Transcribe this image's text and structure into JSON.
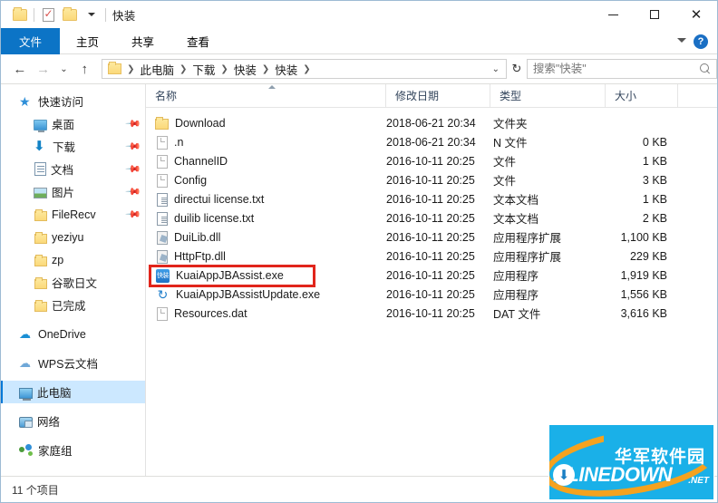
{
  "window": {
    "title": "快装",
    "quick_access": [
      {
        "name": "folder-icon",
        "label": "快装"
      },
      {
        "name": "properties-icon",
        "label": "属性"
      },
      {
        "name": "new-folder-icon",
        "label": "新建文件夹"
      }
    ],
    "controls": {
      "minimize": "—",
      "maximize": "☐",
      "close": "✕"
    }
  },
  "ribbon": {
    "tabs": [
      {
        "label": "文件",
        "active": true
      },
      {
        "label": "主页",
        "active": false
      },
      {
        "label": "共享",
        "active": false
      },
      {
        "label": "查看",
        "active": false
      }
    ],
    "expand_label": "展开功能区",
    "help_label": "?"
  },
  "navbar": {
    "back": "←",
    "forward": "→",
    "recent": "⌄",
    "up": "↑",
    "breadcrumbs": [
      "此电脑",
      "下载",
      "快装",
      "快装"
    ],
    "history_caret": "⌄",
    "refresh": "↻"
  },
  "search": {
    "placeholder": "搜索\"快装\"",
    "value": "",
    "icon": "search-icon"
  },
  "sidebar": {
    "items": [
      {
        "label": "快速访问",
        "icon": "star-icon",
        "level": 0,
        "pinned": false,
        "selected": false
      },
      {
        "label": "桌面",
        "icon": "desktop-icon",
        "level": 1,
        "pinned": true,
        "selected": false
      },
      {
        "label": "下载",
        "icon": "download-icon",
        "level": 1,
        "pinned": true,
        "selected": false
      },
      {
        "label": "文档",
        "icon": "documents-icon",
        "level": 1,
        "pinned": true,
        "selected": false
      },
      {
        "label": "图片",
        "icon": "pictures-icon",
        "level": 1,
        "pinned": true,
        "selected": false
      },
      {
        "label": "FileRecv",
        "icon": "folder-icon",
        "level": 1,
        "pinned": true,
        "selected": false
      },
      {
        "label": "yeziyu",
        "icon": "folder-icon",
        "level": 1,
        "pinned": false,
        "selected": false
      },
      {
        "label": "zp",
        "icon": "folder-icon",
        "level": 1,
        "pinned": false,
        "selected": false
      },
      {
        "label": "谷歌日文",
        "icon": "folder-icon",
        "level": 1,
        "pinned": false,
        "selected": false
      },
      {
        "label": "已完成",
        "icon": "folder-icon",
        "level": 1,
        "pinned": false,
        "selected": false
      },
      {
        "label": "OneDrive",
        "icon": "onedrive-icon",
        "level": 0,
        "pinned": false,
        "selected": false
      },
      {
        "label": "WPS云文档",
        "icon": "wps-cloud-icon",
        "level": 0,
        "pinned": false,
        "selected": false
      },
      {
        "label": "此电脑",
        "icon": "this-pc-icon",
        "level": 0,
        "pinned": false,
        "selected": true
      },
      {
        "label": "网络",
        "icon": "network-icon",
        "level": 0,
        "pinned": false,
        "selected": false
      },
      {
        "label": "家庭组",
        "icon": "homegroup-icon",
        "level": 0,
        "pinned": false,
        "selected": false
      }
    ]
  },
  "filelist": {
    "columns": [
      {
        "label": "名称",
        "sorted": "asc"
      },
      {
        "label": "修改日期",
        "sorted": null
      },
      {
        "label": "类型",
        "sorted": null
      },
      {
        "label": "大小",
        "sorted": null
      }
    ],
    "rows": [
      {
        "name": "Download",
        "date": "2018-06-21 20:34",
        "type": "文件夹",
        "size": "",
        "icon": "folder-icon",
        "highlighted": false
      },
      {
        "name": ".n",
        "date": "2018-06-21 20:34",
        "type": "N 文件",
        "size": "0 KB",
        "icon": "generic-file-icon",
        "highlighted": false
      },
      {
        "name": "ChannelID",
        "date": "2016-10-11 20:25",
        "type": "文件",
        "size": "1 KB",
        "icon": "generic-file-icon",
        "highlighted": false
      },
      {
        "name": "Config",
        "date": "2016-10-11 20:25",
        "type": "文件",
        "size": "3 KB",
        "icon": "generic-file-icon",
        "highlighted": false
      },
      {
        "name": "directui license.txt",
        "date": "2016-10-11 20:25",
        "type": "文本文档",
        "size": "1 KB",
        "icon": "text-file-icon",
        "highlighted": false
      },
      {
        "name": "duilib license.txt",
        "date": "2016-10-11 20:25",
        "type": "文本文档",
        "size": "2 KB",
        "icon": "text-file-icon",
        "highlighted": false
      },
      {
        "name": "DuiLib.dll",
        "date": "2016-10-11 20:25",
        "type": "应用程序扩展",
        "size": "1,100 KB",
        "icon": "dll-file-icon",
        "highlighted": false
      },
      {
        "name": "HttpFtp.dll",
        "date": "2016-10-11 20:25",
        "type": "应用程序扩展",
        "size": "229 KB",
        "icon": "dll-file-icon",
        "highlighted": false
      },
      {
        "name": "KuaiAppJBAssist.exe",
        "date": "2016-10-11 20:25",
        "type": "应用程序",
        "size": "1,919 KB",
        "icon": "kuaiapp-exe-icon",
        "icon_text": "快装",
        "highlighted": true
      },
      {
        "name": "KuaiAppJBAssistUpdate.exe",
        "date": "2016-10-11 20:25",
        "type": "应用程序",
        "size": "1,556 KB",
        "icon": "update-exe-icon",
        "highlighted": false
      },
      {
        "name": "Resources.dat",
        "date": "2016-10-11 20:25",
        "type": "DAT 文件",
        "size": "3,616 KB",
        "icon": "dat-file-icon",
        "highlighted": false
      }
    ]
  },
  "statusbar": {
    "item_count": "11 个项目"
  },
  "watermark": {
    "cn_text": "华军软件园",
    "en_text": "NLINEDOWN",
    "tld": ".NET",
    "bg_color": "#1ab0e8",
    "accent_color": "#f5a21e"
  },
  "colors": {
    "accent": "#0c74c6",
    "selection": "#cce8ff",
    "highlight_box": "#e1251b"
  }
}
